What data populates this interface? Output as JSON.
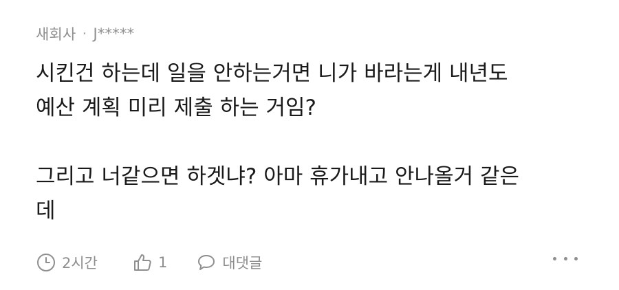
{
  "comment": {
    "author": {
      "company": "새회사",
      "separator": "·",
      "name": "J*****"
    },
    "paragraphs": [
      "시킨건 하는데 일을 안하는거면 니가 바라는게 내년도\n예산 계획 미리 제출 하는 거임?",
      "그리고 너같으면 하겟냐? 아마 휴가내고 안나올거 같은\n데"
    ],
    "actions": {
      "time": {
        "icon": "clock-icon",
        "label": "2시간"
      },
      "like": {
        "icon": "thumbs-up-icon",
        "count": "1"
      },
      "reply": {
        "icon": "speech-bubble-icon",
        "label": "대댓글"
      },
      "more": {
        "icon": "more-horizontal-icon"
      }
    },
    "colors": {
      "text": "#1a1a1a",
      "muted": "#8e8e8e",
      "background": "#ffffff"
    }
  }
}
